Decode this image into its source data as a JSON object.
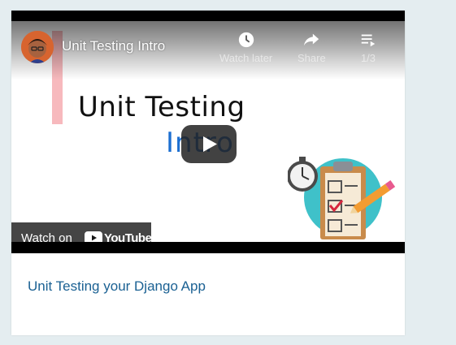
{
  "video": {
    "title": "Unit Testing Intro",
    "slide_title": "Unit Testing",
    "slide_subtitle": "Intro",
    "controls": [
      {
        "label": "Watch later",
        "icon": "clock-icon"
      },
      {
        "label": "Share",
        "icon": "share-arrow-icon"
      },
      {
        "label": "1/3",
        "icon": "playlist-icon"
      }
    ],
    "watch_on_label": "Watch on",
    "youtube_wordmark": "YouTube"
  },
  "card": {
    "caption": "Unit Testing your Django App"
  },
  "colors": {
    "page_background": "#e4edf0",
    "caption_link": "#1b6193",
    "slide_subtitle": "#1c6fd1",
    "accent_pink": "#f7b9bd",
    "clipboard_circle": "#3fc1c9"
  }
}
